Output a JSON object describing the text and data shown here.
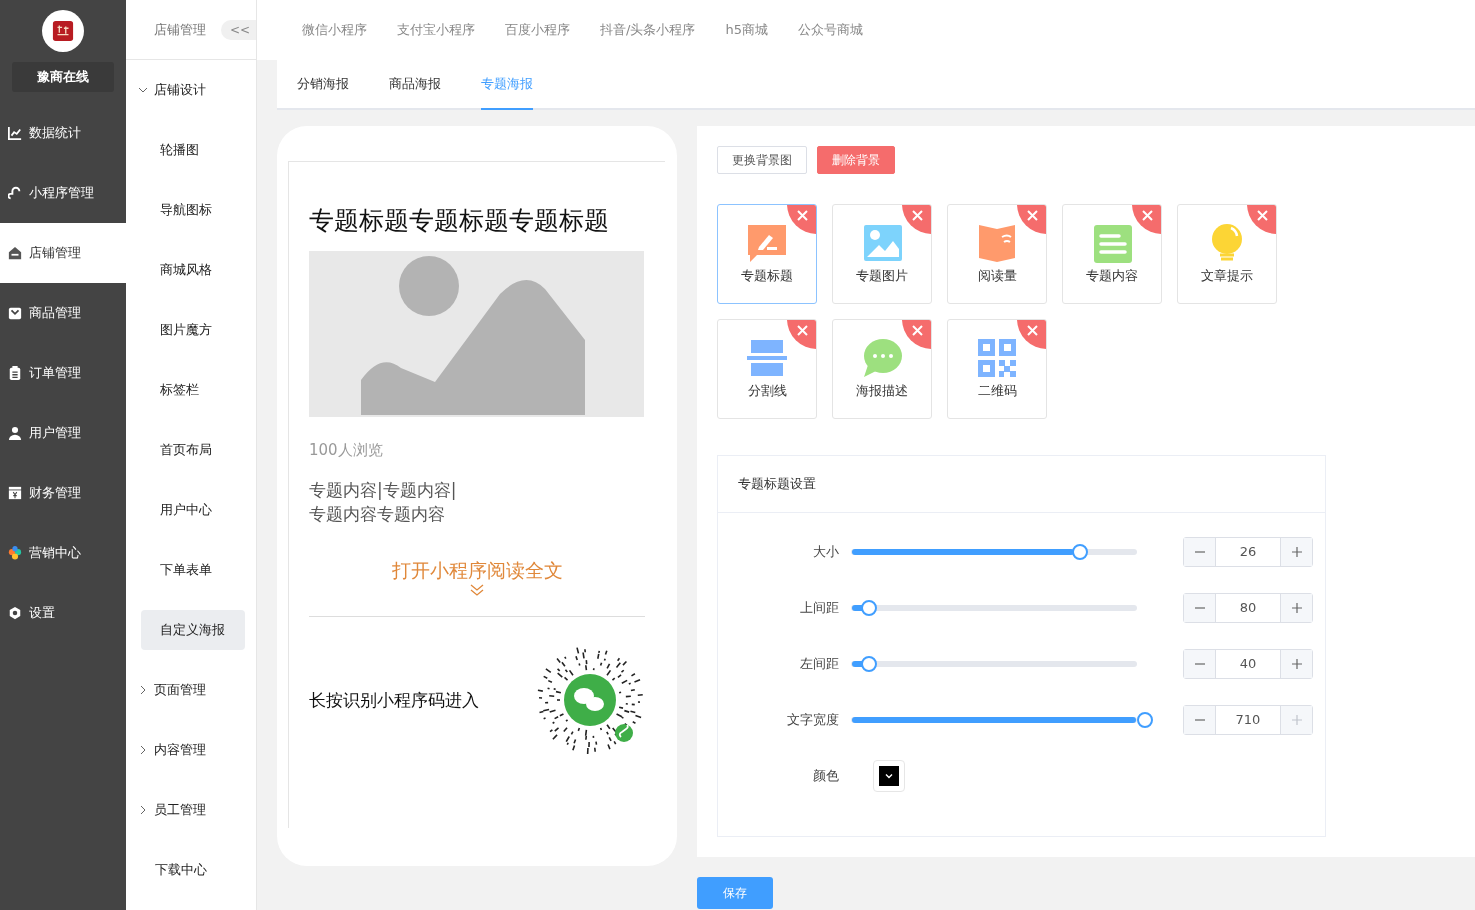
{
  "nav": {
    "logo_name": "豫商在线",
    "items": [
      {
        "kind": "chart",
        "label": "数据统计",
        "selected": false
      },
      {
        "kind": "link",
        "label": "小程序管理",
        "selected": false
      },
      {
        "kind": "shop",
        "label": "店铺管理",
        "selected": true
      },
      {
        "kind": "bag",
        "label": "商品管理",
        "selected": false
      },
      {
        "kind": "clipboard",
        "label": "订单管理",
        "selected": false
      },
      {
        "kind": "user",
        "label": "用户管理",
        "selected": false
      },
      {
        "kind": "yen",
        "label": "财务管理",
        "selected": false
      },
      {
        "kind": "clover",
        "label": "营销中心",
        "selected": false
      },
      {
        "kind": "gear",
        "label": "设置",
        "selected": false
      }
    ]
  },
  "sub_sidebar": {
    "title": "店铺管理",
    "collapse": "<<",
    "items": [
      {
        "label": "店铺设计",
        "expanded": true,
        "children": [
          {
            "label": "轮播图",
            "selected": false
          },
          {
            "label": "导航图标",
            "selected": false
          },
          {
            "label": "商城风格",
            "selected": false
          },
          {
            "label": "图片魔方",
            "selected": false
          },
          {
            "label": "标签栏",
            "selected": false
          },
          {
            "label": "首页布局",
            "selected": false
          },
          {
            "label": "用户中心",
            "selected": false
          },
          {
            "label": "下单表单",
            "selected": false
          },
          {
            "label": "自定义海报",
            "selected": true
          }
        ]
      },
      {
        "label": "页面管理",
        "expanded": false
      },
      {
        "label": "内容管理",
        "expanded": false
      },
      {
        "label": "员工管理",
        "expanded": false
      },
      {
        "label": "下载中心"
      }
    ]
  },
  "platform_tabs": [
    "微信小程序",
    "支付宝小程序",
    "百度小程序",
    "抖音/头条小程序",
    "h5商城",
    "公众号商城"
  ],
  "poster_tabs": [
    {
      "label": "分销海报",
      "selected": false
    },
    {
      "label": "商品海报",
      "selected": false
    },
    {
      "label": "专题海报",
      "selected": true
    }
  ],
  "preview": {
    "title": "专题标题专题标题专题标题",
    "views": "100人浏览",
    "content_lines": [
      "专题内容|专题内容|",
      "专题内容专题内容"
    ],
    "read_more": "打开小程序阅读全文",
    "qr_caption": "长按识别小程序码进入"
  },
  "background_buttons": [
    {
      "kind": "plain",
      "label": "更换背景图"
    },
    {
      "kind": "danger",
      "label": "删除背景"
    }
  ],
  "components": [
    {
      "kind": "title",
      "label": "专题标题",
      "selected": true
    },
    {
      "kind": "image",
      "label": "专题图片",
      "selected": false
    },
    {
      "kind": "book",
      "label": "阅读量",
      "selected": false
    },
    {
      "kind": "text",
      "label": "专题内容",
      "selected": false
    },
    {
      "kind": "bulb",
      "label": "文章提示",
      "selected": false
    },
    {
      "kind": "divider",
      "label": "分割线",
      "selected": false
    },
    {
      "kind": "chat",
      "label": "海报描述",
      "selected": false
    },
    {
      "kind": "qr",
      "label": "二维码",
      "selected": false
    }
  ],
  "settings": {
    "title": "专题标题设置",
    "sliders": [
      {
        "label": "大小",
        "level": 0.78,
        "value": "26",
        "plus_disabled": false
      },
      {
        "label": "上间距",
        "level": 0.06,
        "value": "80",
        "plus_disabled": false
      },
      {
        "label": "左间距",
        "level": 0.06,
        "value": "40",
        "plus_disabled": false
      },
      {
        "label": "文字宽度",
        "level": 1.0,
        "value": "710",
        "plus_disabled": true
      }
    ],
    "color_field": {
      "label": "颜色",
      "color": "#000000"
    }
  },
  "save_button": "保存"
}
